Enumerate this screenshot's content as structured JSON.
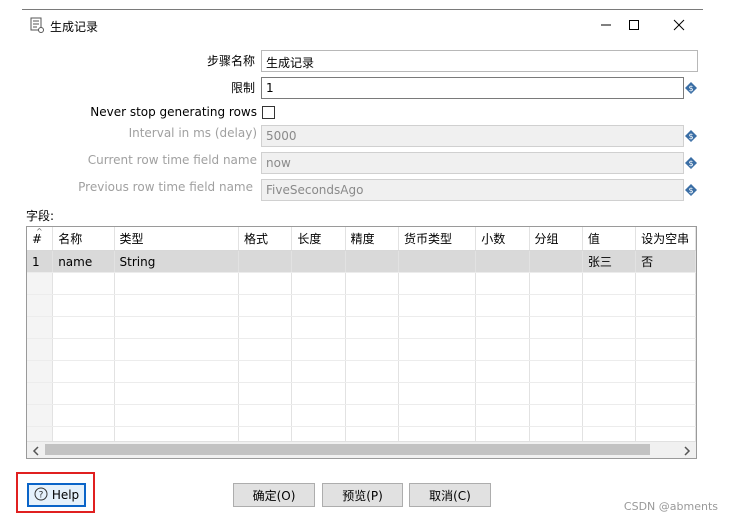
{
  "window": {
    "title": "生成记录",
    "icon": "document-step-icon",
    "minimize_icon": "minimize-icon",
    "maximize_icon": "maximize-icon",
    "close_icon": "close-icon"
  },
  "form": {
    "step_name": {
      "label": "步骤名称",
      "value": "生成记录"
    },
    "limit": {
      "label": "限制",
      "value": "1"
    },
    "never_stop": {
      "label": "Never stop generating rows",
      "checked": false
    },
    "interval": {
      "label": "Interval in ms (delay)",
      "value": "5000"
    },
    "current_time_field": {
      "label": "Current row time field name",
      "value": "now"
    },
    "previous_time_field": {
      "label": "Previous row time field name",
      "value": "FiveSecondsAgo"
    },
    "variable_icon": "variable-diamond-icon"
  },
  "fields": {
    "label": "字段:",
    "columns": [
      "#",
      "名称",
      "类型",
      "格式",
      "长度",
      "精度",
      "货币类型",
      "小数",
      "分组",
      "值",
      "设为空串"
    ],
    "rows": [
      [
        "1",
        "name",
        "String",
        "",
        "",
        "",
        "",
        "",
        "",
        "张三",
        "否"
      ]
    ]
  },
  "buttons": {
    "help": "Help",
    "ok": "确定(O)",
    "preview": "预览(P)",
    "cancel": "取消(C)"
  },
  "watermark": "CSDN @abments"
}
